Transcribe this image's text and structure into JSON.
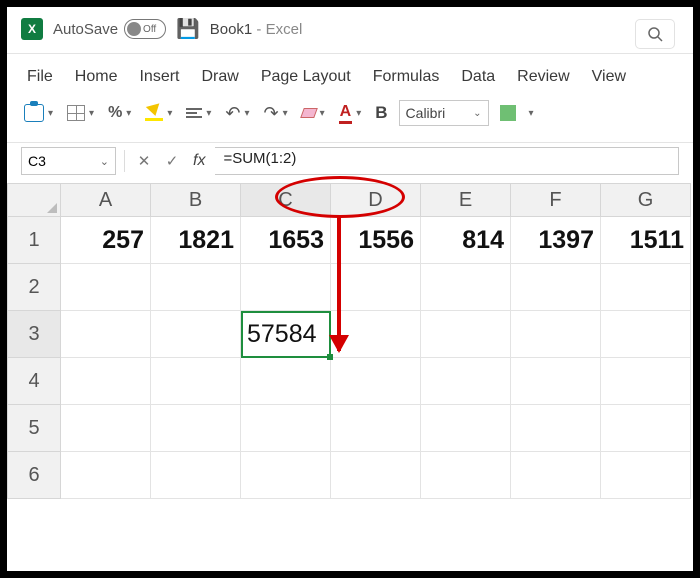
{
  "titlebar": {
    "autosave_label": "AutoSave",
    "autosave_state": "Off",
    "doc_name": "Book1",
    "app_suffix": " -  Excel"
  },
  "menu": {
    "items": [
      "File",
      "Home",
      "Insert",
      "Draw",
      "Page Layout",
      "Formulas",
      "Data",
      "Review",
      "View"
    ]
  },
  "ribbon": {
    "font_name": "Calibri",
    "bold_label": "B"
  },
  "formula_bar": {
    "name_box": "C3",
    "fx_label": "fx",
    "formula": "=SUM(1:2)"
  },
  "grid": {
    "columns": [
      "A",
      "B",
      "C",
      "D",
      "E",
      "F",
      "G"
    ],
    "row_labels": [
      "1",
      "2",
      "3",
      "4",
      "5",
      "6"
    ],
    "cells": {
      "r1": {
        "A": "257",
        "B": "1821",
        "C": "1653",
        "D": "1556",
        "E": "814",
        "F": "1397",
        "G": "1511"
      },
      "r3": {
        "C": "57584"
      }
    },
    "selected_cell": "C3"
  },
  "chart_data": {
    "type": "table",
    "note": "Excel spreadsheet; formula =SUM(1:2) in C3 yields 57584",
    "columns": [
      "A",
      "B",
      "C",
      "D",
      "E",
      "F",
      "G"
    ],
    "rows": [
      {
        "row": 1,
        "A": 257,
        "B": 1821,
        "C": 1653,
        "D": 1556,
        "E": 814,
        "F": 1397,
        "G": 1511
      },
      {
        "row": 3,
        "C": 57584
      }
    ]
  }
}
